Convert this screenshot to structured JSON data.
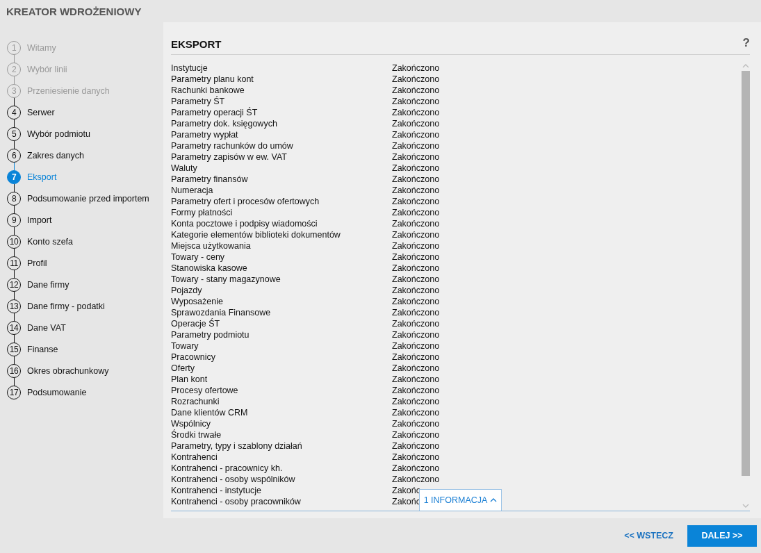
{
  "header": {
    "title": "KREATOR WDROŻENIOWY"
  },
  "steps": [
    {
      "number": "1",
      "label": "Witamy",
      "disabled": true,
      "selected": false
    },
    {
      "number": "2",
      "label": "Wybór linii",
      "disabled": true,
      "selected": false
    },
    {
      "number": "3",
      "label": "Przeniesienie danych",
      "disabled": true,
      "selected": false
    },
    {
      "number": "4",
      "label": "Serwer",
      "disabled": false,
      "selected": false
    },
    {
      "number": "5",
      "label": "Wybór podmiotu",
      "disabled": false,
      "selected": false
    },
    {
      "number": "6",
      "label": "Zakres danych",
      "disabled": false,
      "selected": false
    },
    {
      "number": "7",
      "label": "Eksport",
      "disabled": false,
      "selected": true
    },
    {
      "number": "8",
      "label": "Podsumowanie przed importem",
      "disabled": false,
      "selected": false
    },
    {
      "number": "9",
      "label": "Import",
      "disabled": false,
      "selected": false
    },
    {
      "number": "10",
      "label": "Konto szefa",
      "disabled": false,
      "selected": false
    },
    {
      "number": "11",
      "label": "Profil",
      "disabled": false,
      "selected": false
    },
    {
      "number": "12",
      "label": "Dane firmy",
      "disabled": false,
      "selected": false
    },
    {
      "number": "13",
      "label": "Dane firmy - podatki",
      "disabled": false,
      "selected": false
    },
    {
      "number": "14",
      "label": "Dane VAT",
      "disabled": false,
      "selected": false
    },
    {
      "number": "15",
      "label": "Finanse",
      "disabled": false,
      "selected": false
    },
    {
      "number": "16",
      "label": "Okres obrachunkowy",
      "disabled": false,
      "selected": false
    },
    {
      "number": "17",
      "label": "Podsumowanie",
      "disabled": false,
      "selected": false
    }
  ],
  "panel": {
    "title": "EKSPORT",
    "help": "?",
    "rows": [
      {
        "name": "Instytucje",
        "status": "Zakończono"
      },
      {
        "name": "Parametry planu kont",
        "status": "Zakończono"
      },
      {
        "name": "Rachunki bankowe",
        "status": "Zakończono"
      },
      {
        "name": "Parametry ŚT",
        "status": "Zakończono"
      },
      {
        "name": "Parametry operacji ŚT",
        "status": "Zakończono"
      },
      {
        "name": "Parametry dok. księgowych",
        "status": "Zakończono"
      },
      {
        "name": "Parametry wypłat",
        "status": "Zakończono"
      },
      {
        "name": "Parametry rachunków do umów",
        "status": "Zakończono"
      },
      {
        "name": "Parametry zapisów w ew. VAT",
        "status": "Zakończono"
      },
      {
        "name": "Waluty",
        "status": "Zakończono"
      },
      {
        "name": "Parametry finansów",
        "status": "Zakończono"
      },
      {
        "name": "Numeracja",
        "status": "Zakończono"
      },
      {
        "name": "Parametry ofert i procesów ofertowych",
        "status": "Zakończono"
      },
      {
        "name": "Formy płatności",
        "status": "Zakończono"
      },
      {
        "name": "Konta pocztowe i podpisy wiadomości",
        "status": "Zakończono"
      },
      {
        "name": "Kategorie elementów biblioteki dokumentów",
        "status": "Zakończono"
      },
      {
        "name": "Miejsca użytkowania",
        "status": "Zakończono"
      },
      {
        "name": "Towary - ceny",
        "status": "Zakończono"
      },
      {
        "name": "Stanowiska kasowe",
        "status": "Zakończono"
      },
      {
        "name": "Towary - stany magazynowe",
        "status": "Zakończono"
      },
      {
        "name": "Pojazdy",
        "status": "Zakończono"
      },
      {
        "name": "Wyposażenie",
        "status": "Zakończono"
      },
      {
        "name": "Sprawozdania Finansowe",
        "status": "Zakończono"
      },
      {
        "name": "Operacje ŚT",
        "status": "Zakończono"
      },
      {
        "name": "Parametry podmiotu",
        "status": "Zakończono"
      },
      {
        "name": "Towary",
        "status": "Zakończono"
      },
      {
        "name": "Pracownicy",
        "status": "Zakończono"
      },
      {
        "name": "Oferty",
        "status": "Zakończono"
      },
      {
        "name": "Plan kont",
        "status": "Zakończono"
      },
      {
        "name": "Procesy ofertowe",
        "status": "Zakończono"
      },
      {
        "name": "Rozrachunki",
        "status": "Zakończono"
      },
      {
        "name": "Dane klientów CRM",
        "status": "Zakończono"
      },
      {
        "name": "Wspólnicy",
        "status": "Zakończono"
      },
      {
        "name": "Środki trwałe",
        "status": "Zakończono"
      },
      {
        "name": "Parametry, typy i szablony działań",
        "status": "Zakończono"
      },
      {
        "name": "Kontrahenci",
        "status": "Zakończono"
      },
      {
        "name": "Kontrahenci - pracownicy kh.",
        "status": "Zakończono"
      },
      {
        "name": "Kontrahenci - osoby wspólników",
        "status": "Zakończono"
      },
      {
        "name": "Kontrahenci - instytucje",
        "status": "Zakońc"
      },
      {
        "name": "Kontrahenci - osoby pracowników",
        "status": "Zakońc"
      }
    ],
    "info": {
      "label": "1 INFORMACJA"
    }
  },
  "footer": {
    "back": "<< WSTECZ",
    "next": "DALEJ >>"
  }
}
